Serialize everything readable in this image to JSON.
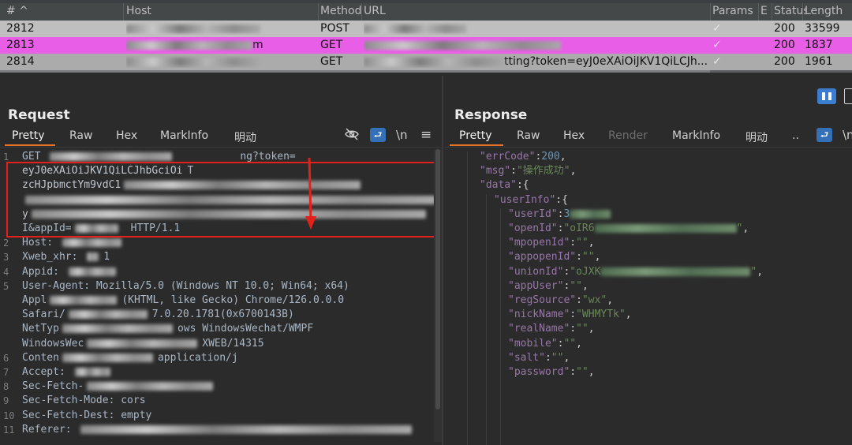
{
  "history": {
    "columns": {
      "num": "# ^",
      "host": "Host",
      "method": "Method",
      "url": "URL",
      "params": "Params",
      "edited": "E",
      "status": "Status",
      "length": "Length"
    },
    "rows": [
      {
        "num": "2812",
        "method": "POST",
        "params": "✓",
        "status": "200",
        "length": "33599"
      },
      {
        "num": "2813",
        "host_suffix": "m",
        "method": "GET",
        "params": "✓",
        "status": "200",
        "length": "1837"
      },
      {
        "num": "2814",
        "method": "GET",
        "url_suffix": "tting?token=eyJ0eXAiOiJKV1QiLCJh...",
        "params": "✓",
        "status": "200",
        "length": "1961"
      }
    ]
  },
  "request": {
    "title": "Request",
    "tabs": [
      "Pretty",
      "Raw",
      "Hex",
      "MarkInfo",
      "明动"
    ],
    "icons": {
      "hide": "eye-slash-icon",
      "wrap": "word-wrap-icon",
      "newline": "\\n",
      "menu": "≡"
    },
    "lines": [
      {
        "n": "1",
        "text": "GET ",
        "tail": "ng?token="
      },
      {
        "n": "",
        "text": "eyJ0eXAiOiJKV1QiLCJhbGciOi",
        "tail": "T"
      },
      {
        "n": "",
        "text": "zcHJpbmctYm9vdC1"
      },
      {
        "n": "",
        "text": ""
      },
      {
        "n": "",
        "text": "y"
      },
      {
        "n": "",
        "text": "I&appId=",
        "tail": "HTTP/1.1"
      },
      {
        "n": "2",
        "text": "Host: "
      },
      {
        "n": "3",
        "text": "Xweb_xhr: ",
        "tail": "1"
      },
      {
        "n": "4",
        "text": "Appid: "
      },
      {
        "n": "5",
        "text": "User-Agent: Mozilla/5.0 (Windows NT 10.0; Win64; x64)"
      },
      {
        "n": "",
        "text": "Appl",
        "tail": "(KHTML, like Gecko) Chrome/126.0.0.0"
      },
      {
        "n": "",
        "text": "Safari/",
        "tail": "7.0.20.1781(0x6700143B)"
      },
      {
        "n": "",
        "text": "NetTyp",
        "tail": "ows WindowsWechat/WMPF"
      },
      {
        "n": "",
        "text": "WindowsWec",
        "tail": "XWEB/14315"
      },
      {
        "n": "6",
        "text": "Conten",
        "tail": "application/j"
      },
      {
        "n": "7",
        "text": "Accept: "
      },
      {
        "n": "8",
        "text": "Sec-Fetch-"
      },
      {
        "n": "9",
        "text": "Sec-Fetch-Mode: cors"
      },
      {
        "n": "10",
        "text": "Sec-Fetch-Dest: empty"
      },
      {
        "n": "11",
        "text": "Referer: "
      }
    ]
  },
  "response": {
    "title": "Response",
    "tabs": [
      "Pretty",
      "Raw",
      "Hex",
      "Render",
      "MarkInfo",
      "明动",
      ".."
    ],
    "icons": {
      "wrap": "word-wrap-icon",
      "newline": "\\n",
      "layout": "layout-columns-icon"
    },
    "json": [
      {
        "indent": 1,
        "key": "errCode",
        "sep": ":",
        "num": "200",
        "end": ","
      },
      {
        "indent": 1,
        "key": "msg",
        "sep": ":",
        "str": "\"操作成功\"",
        "end": ","
      },
      {
        "indent": 1,
        "key": "data",
        "sep": ":{"
      },
      {
        "indent": 2,
        "key": "userInfo",
        "sep": ":{"
      },
      {
        "indent": 3,
        "key": "userId",
        "sep": ":",
        "num": "3"
      },
      {
        "indent": 3,
        "key": "openId",
        "sep": ":",
        "str": "\"oIR6",
        "end": ","
      },
      {
        "indent": 3,
        "key": "mpopenId",
        "sep": ":",
        "str": "\"\"",
        "end": ","
      },
      {
        "indent": 3,
        "key": "appopenId",
        "sep": ":",
        "str": "\"\"",
        "end": ","
      },
      {
        "indent": 3,
        "key": "unionId",
        "sep": ":",
        "str": "\"oJXK",
        "end": ","
      },
      {
        "indent": 3,
        "key": "appUser",
        "sep": ":",
        "str": "\"\"",
        "end": ","
      },
      {
        "indent": 3,
        "key": "regSource",
        "sep": ":",
        "str": "\"wx\"",
        "end": ","
      },
      {
        "indent": 3,
        "key": "nickName",
        "sep": ":",
        "str": "\"WHMYTk\"",
        "end": ","
      },
      {
        "indent": 3,
        "key": "realName",
        "sep": ":",
        "str": "\"\"",
        "end": ","
      },
      {
        "indent": 3,
        "key": "mobile",
        "sep": ":",
        "str": "\"\"",
        "end": ","
      },
      {
        "indent": 3,
        "key": "salt",
        "sep": ":",
        "str": "\"\"",
        "end": ","
      },
      {
        "indent": 3,
        "key": "password",
        "sep": ":",
        "str": "\"\"",
        "end": ","
      }
    ]
  },
  "colors": {
    "highlight_row": "#e85ee6",
    "selected_tab": "#e8722a",
    "annotation": "#e3211a",
    "json_key": "#9876aa",
    "json_string": "#6a8759",
    "json_number": "#6897bb"
  }
}
